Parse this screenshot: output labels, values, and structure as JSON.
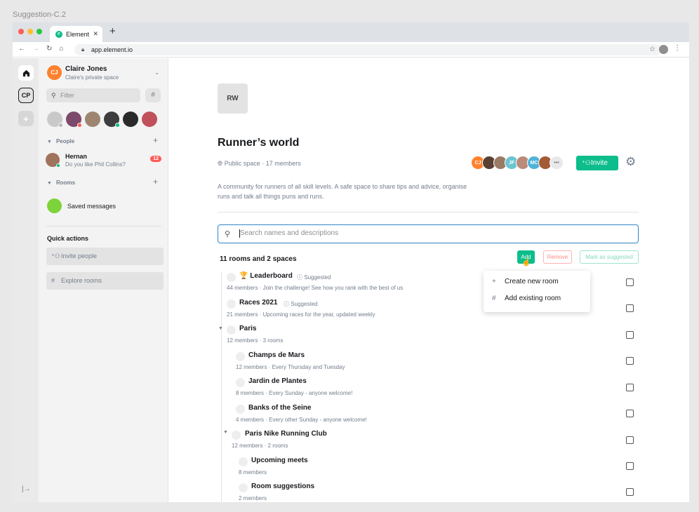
{
  "frame_label": "Suggestion-C.2",
  "browser": {
    "tab_title": "Element",
    "url": "app.element.io",
    "new_tab": "+",
    "close": "✕"
  },
  "rail": {
    "space_initials": "CP",
    "add": "+"
  },
  "space": {
    "initials": "CJ",
    "name": "Claire Jones",
    "subtitle": "Claire's private space"
  },
  "filter_placeholder": "Filter",
  "people": {
    "header": "People",
    "dm": {
      "name": "Hernan",
      "message": "Do you like Phil Collins?",
      "badge": "12"
    }
  },
  "rooms": {
    "header": "Rooms",
    "saved_messages": "Saved messages"
  },
  "quick_actions": {
    "title": "Quick actions",
    "invite": "Invite people",
    "explore": "Explore rooms"
  },
  "room": {
    "avatar": "RW",
    "title": "Runner’s world",
    "meta": "Public space · 17 members",
    "members": [
      "CJ",
      "",
      "",
      "JF",
      "",
      "MC",
      "",
      "•••"
    ],
    "invite": "Invite",
    "topic": "A community for runners of all skill levels. A safe space to share tips and advice, organise runs and talk all things puns and runs.",
    "search_placeholder": "Search names and descriptions",
    "count": "11 rooms and 2 spaces",
    "add": "Add",
    "remove": "Remove",
    "mark_suggested": "Mark as suggested"
  },
  "add_menu": {
    "create": "Create new room",
    "existing": "Add existing room"
  },
  "list": [
    {
      "name": "🏆 Leaderboard",
      "suggested": "Suggested",
      "sub": "44 members  ·  Join the challenge! See how you rank with the best of us"
    },
    {
      "name": "Races 2021",
      "suggested": "Suggested",
      "sub": "21 members  ·  Upcoming races for the year, updated weekly"
    },
    {
      "name": "Paris",
      "suggested": "",
      "sub": "12 members  ·  3 rooms"
    },
    {
      "name": "Champs de Mars",
      "suggested": "",
      "sub": "12 members  ·  Every Thursday and Tuesday"
    },
    {
      "name": "Jardin de Plantes",
      "suggested": "",
      "sub": "8 members  ·  Every Sunday - anyone welcome!"
    },
    {
      "name": "Banks of the Seine",
      "suggested": "",
      "sub": "4 members  ·  Every other Sunday - anyone welcome!"
    },
    {
      "name": "Paris Nike Running Club",
      "suggested": "",
      "sub": "12 members  ·  2 rooms"
    },
    {
      "name": "Upcoming meets",
      "suggested": "",
      "sub": "8 members"
    },
    {
      "name": "Room suggestions",
      "suggested": "",
      "sub": "2 members"
    }
  ],
  "colors": {
    "accent": "#0dbd8b",
    "focus": "#2f86c5",
    "badge": "#ff5b55"
  }
}
